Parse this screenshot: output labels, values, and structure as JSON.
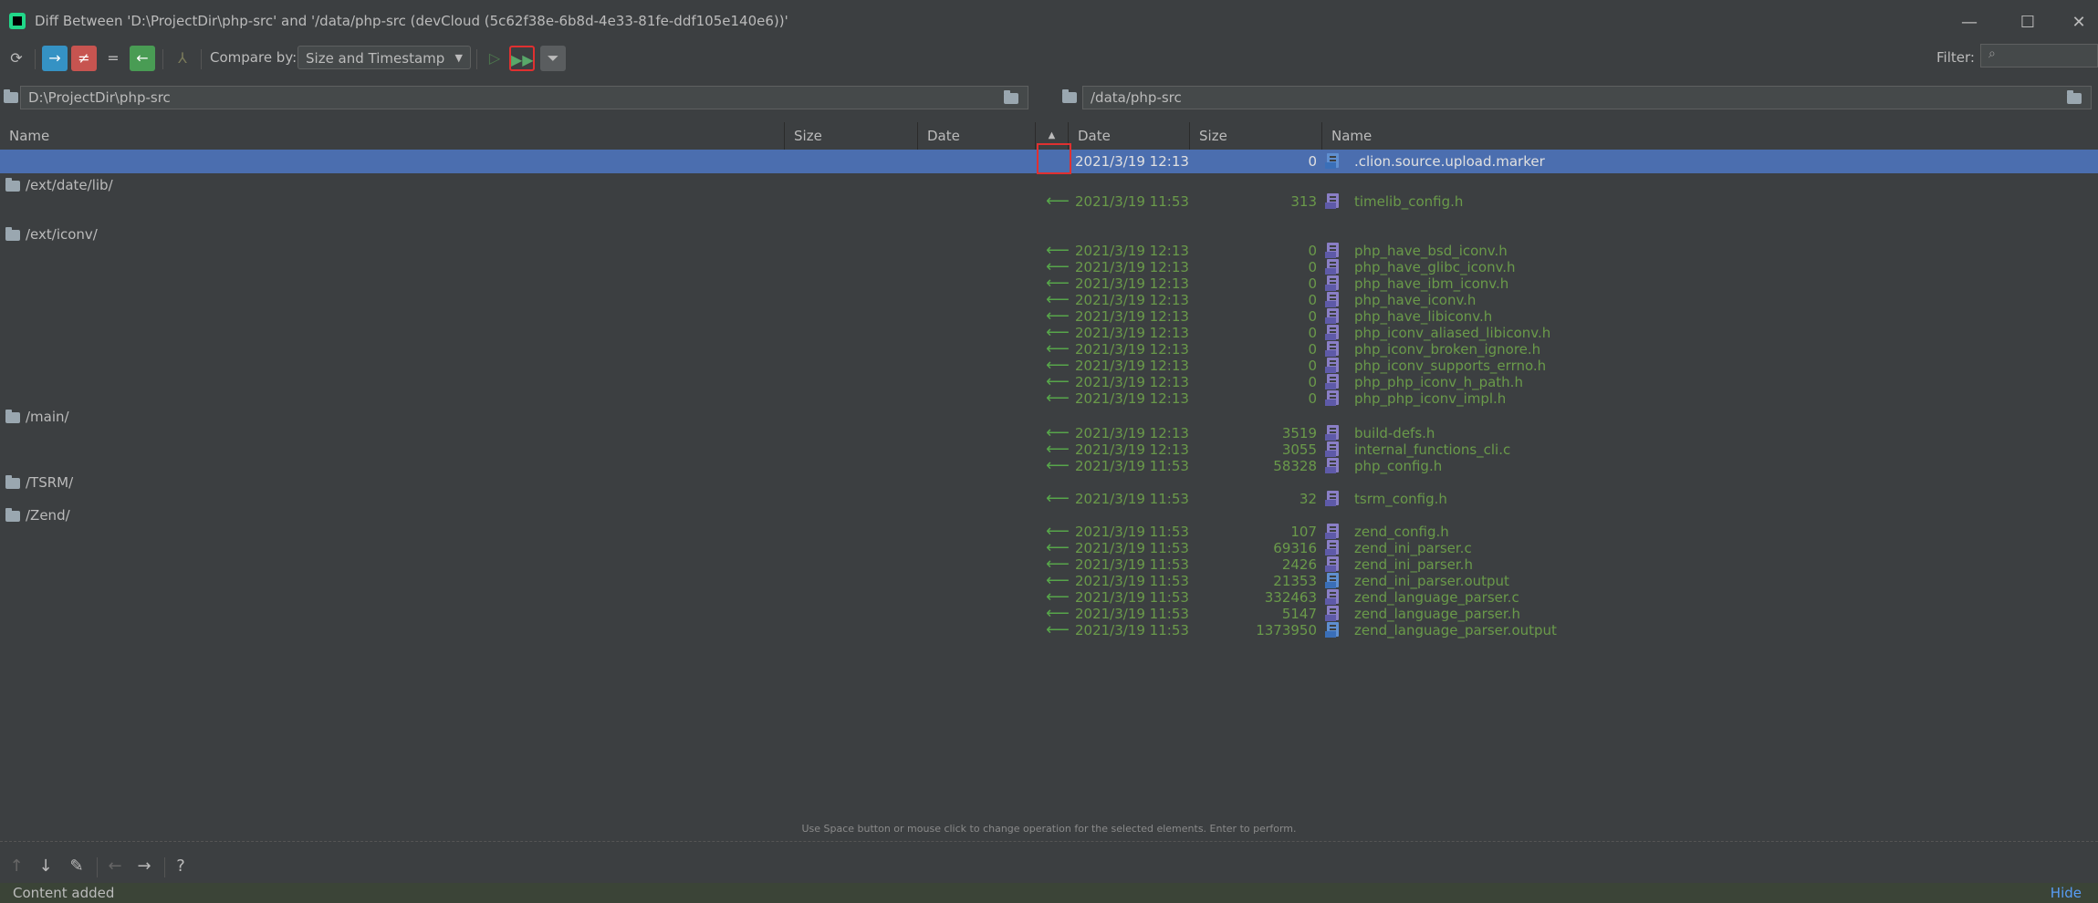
{
  "window": {
    "title": "Diff Between 'D:\\ProjectDir\\php-src' and '/data/php-src (devCloud (5c62f38e-6b8d-4e33-81fe-ddf105e140e6))'",
    "minimize_label": "—",
    "maximize_label": "☐",
    "close_label": "✕"
  },
  "toolbar": {
    "compare_by_label": "Compare by:",
    "compare_by_value": "Size and Timestamp",
    "filter_label": "Filter:"
  },
  "paths": {
    "left": "D:\\ProjectDir\\php-src",
    "right": "/data/php-src"
  },
  "columns": {
    "left_name": "Name",
    "left_size": "Size",
    "left_date": "Date",
    "sort_indicator": "▲",
    "right_date": "Date",
    "right_size": "Size",
    "right_name": "Name"
  },
  "rows": [
    {
      "kind": "file",
      "selected": true,
      "arrow": "",
      "date": "2021/3/19 12:13",
      "size": "0",
      "name": ".clion.source.upload.marker",
      "icon": "text-file-icon"
    },
    {
      "kind": "dir",
      "name": "/ext/date/lib/"
    },
    {
      "kind": "file",
      "arrow": "⟵",
      "date": "2021/3/19 11:53",
      "size": "313",
      "name": "timelib_config.h",
      "icon": "c-header-icon"
    },
    {
      "kind": "dir",
      "name": "/ext/iconv/"
    },
    {
      "kind": "file",
      "arrow": "⟵",
      "date": "2021/3/19 12:13",
      "size": "0",
      "name": "php_have_bsd_iconv.h",
      "icon": "c-header-icon"
    },
    {
      "kind": "file",
      "arrow": "⟵",
      "date": "2021/3/19 12:13",
      "size": "0",
      "name": "php_have_glibc_iconv.h",
      "icon": "c-header-icon"
    },
    {
      "kind": "file",
      "arrow": "⟵",
      "date": "2021/3/19 12:13",
      "size": "0",
      "name": "php_have_ibm_iconv.h",
      "icon": "c-header-icon"
    },
    {
      "kind": "file",
      "arrow": "⟵",
      "date": "2021/3/19 12:13",
      "size": "0",
      "name": "php_have_iconv.h",
      "icon": "c-header-icon"
    },
    {
      "kind": "file",
      "arrow": "⟵",
      "date": "2021/3/19 12:13",
      "size": "0",
      "name": "php_have_libiconv.h",
      "icon": "c-header-icon"
    },
    {
      "kind": "file",
      "arrow": "⟵",
      "date": "2021/3/19 12:13",
      "size": "0",
      "name": "php_iconv_aliased_libiconv.h",
      "icon": "c-header-icon"
    },
    {
      "kind": "file",
      "arrow": "⟵",
      "date": "2021/3/19 12:13",
      "size": "0",
      "name": "php_iconv_broken_ignore.h",
      "icon": "c-header-icon"
    },
    {
      "kind": "file",
      "arrow": "⟵",
      "date": "2021/3/19 12:13",
      "size": "0",
      "name": "php_iconv_supports_errno.h",
      "icon": "c-header-icon"
    },
    {
      "kind": "file",
      "arrow": "⟵",
      "date": "2021/3/19 12:13",
      "size": "0",
      "name": "php_php_iconv_h_path.h",
      "icon": "c-header-icon"
    },
    {
      "kind": "file",
      "arrow": "⟵",
      "date": "2021/3/19 12:13",
      "size": "0",
      "name": "php_php_iconv_impl.h",
      "icon": "c-header-icon"
    },
    {
      "kind": "dir",
      "name": "/main/"
    },
    {
      "kind": "file",
      "arrow": "⟵",
      "date": "2021/3/19 12:13",
      "size": "3519",
      "name": "build-defs.h",
      "icon": "c-header-icon"
    },
    {
      "kind": "file",
      "arrow": "⟵",
      "date": "2021/3/19 12:13",
      "size": "3055",
      "name": "internal_functions_cli.c",
      "icon": "c-source-icon"
    },
    {
      "kind": "file",
      "arrow": "⟵",
      "date": "2021/3/19 11:53",
      "size": "58328",
      "name": "php_config.h",
      "icon": "c-header-icon"
    },
    {
      "kind": "dir",
      "name": "/TSRM/"
    },
    {
      "kind": "file",
      "arrow": "⟵",
      "date": "2021/3/19 11:53",
      "size": "32",
      "name": "tsrm_config.h",
      "icon": "c-header-icon"
    },
    {
      "kind": "dir",
      "name": "/Zend/"
    },
    {
      "kind": "file",
      "arrow": "⟵",
      "date": "2021/3/19 11:53",
      "size": "107",
      "name": "zend_config.h",
      "icon": "c-header-icon"
    },
    {
      "kind": "file",
      "arrow": "⟵",
      "date": "2021/3/19 11:53",
      "size": "69316",
      "name": "zend_ini_parser.c",
      "icon": "c-source-icon"
    },
    {
      "kind": "file",
      "arrow": "⟵",
      "date": "2021/3/19 11:53",
      "size": "2426",
      "name": "zend_ini_parser.h",
      "icon": "c-header-icon"
    },
    {
      "kind": "file",
      "arrow": "⟵",
      "date": "2021/3/19 11:53",
      "size": "21353",
      "name": "zend_ini_parser.output",
      "icon": "text-file-icon"
    },
    {
      "kind": "file",
      "arrow": "⟵",
      "date": "2021/3/19 11:53",
      "size": "332463",
      "name": "zend_language_parser.c",
      "icon": "c-source-icon"
    },
    {
      "kind": "file",
      "arrow": "⟵",
      "date": "2021/3/19 11:53",
      "size": "5147",
      "name": "zend_language_parser.h",
      "icon": "c-header-icon"
    },
    {
      "kind": "file",
      "arrow": "⟵",
      "date": "2021/3/19 11:53",
      "size": "1373950",
      "name": "zend_language_parser.output",
      "icon": "text-file-icon"
    }
  ],
  "hint": "Use Space button or mouse click to change operation for the selected elements. Enter to perform.",
  "status": {
    "message": "Content added",
    "hide_label": "Hide"
  },
  "colors": {
    "selection": "#4b6eaf",
    "added_text": "#6a9a4a",
    "highlight_box": "#e03030"
  }
}
